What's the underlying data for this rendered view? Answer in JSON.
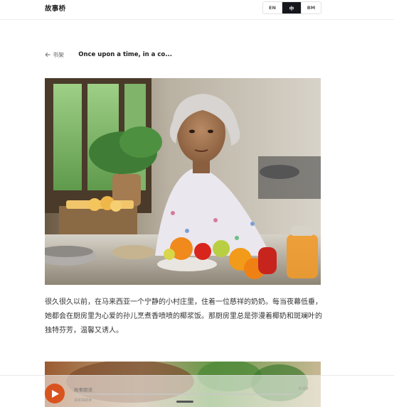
{
  "header": {
    "brand": "故事桥",
    "languages": [
      {
        "label": "EN",
        "active": false
      },
      {
        "label": "中",
        "active": true
      },
      {
        "label": "BM",
        "active": false
      }
    ]
  },
  "breadcrumb": {
    "back_label": "书架",
    "title": "Once upon a time, in a co..."
  },
  "story": {
    "paragraph": "很久很久以前，在马来西亚一个宁静的小村庄里，住着一位慈祥的奶奶。每当夜幕低垂，她都会在厨房里为心爱的孙儿烹煮香喷喷的椰浆饭。那厨房里总是弥漫着椰奶和斑斓叶的独特芬芳，温馨又诱人。"
  },
  "player": {
    "title": "故事朗读",
    "subtitle": "讲故事朗读",
    "time": "0:00",
    "progress": 0
  },
  "colors": {
    "accent": "#d9531e",
    "active_lang_bg": "#15171c"
  },
  "icons": {
    "back": "arrow-left-icon",
    "play": "play-icon"
  }
}
